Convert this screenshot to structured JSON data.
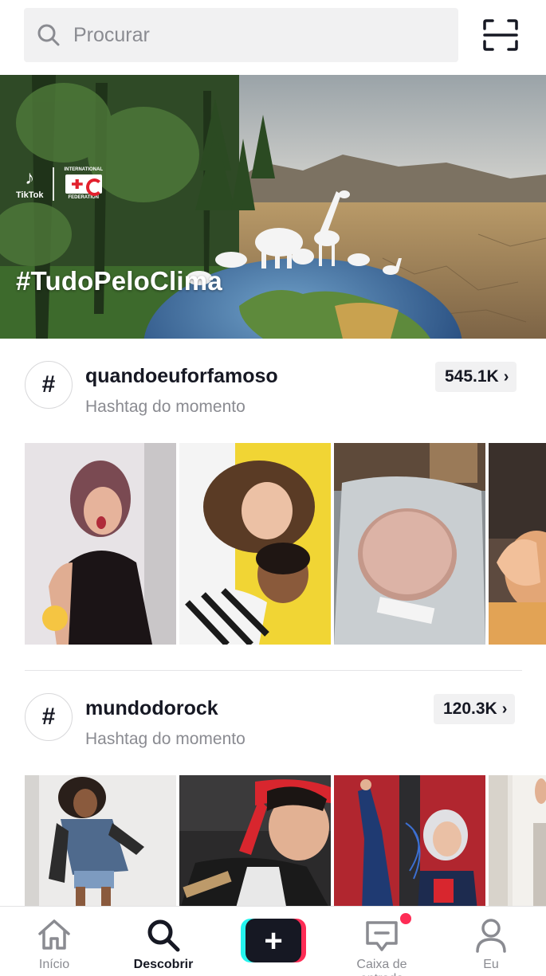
{
  "search": {
    "placeholder": "Procurar",
    "icon": "search-icon",
    "scan_icon": "scan-icon"
  },
  "banner": {
    "brand": "TikTok",
    "partner_line1": "INTERNATIONAL",
    "partner_line2": "FEDERATION",
    "hashtag": "#TudoPeloClima"
  },
  "sections": [
    {
      "title": "quandoeuforfamoso",
      "subtitle": "Hashtag do momento",
      "count": "545.1K",
      "thumbnails": [
        "pink-hair-girl",
        "two-people-selfie",
        "sliced-meat-package",
        "hand-wave"
      ]
    },
    {
      "title": "mundodorock",
      "subtitle": "Hashtag do momento",
      "count": "120.3K",
      "thumbnails": [
        "dancer-denim-jacket",
        "guitarist-red-bandana",
        "rock-drawing-split",
        "hallway"
      ]
    }
  ],
  "nav": {
    "items": [
      {
        "label": "Início",
        "icon": "home-icon"
      },
      {
        "label": "Descobrir",
        "icon": "search-icon"
      },
      {
        "label": "",
        "icon": "plus-icon"
      },
      {
        "label": "Caixa de entrada",
        "icon": "inbox-icon"
      },
      {
        "label": "Eu",
        "icon": "profile-icon"
      }
    ],
    "active": "Descobrir"
  },
  "colors": {
    "accent_red": "#fe2c55",
    "accent_cyan": "#25f4ee",
    "text": "#161823",
    "muted": "#8a8b91"
  }
}
